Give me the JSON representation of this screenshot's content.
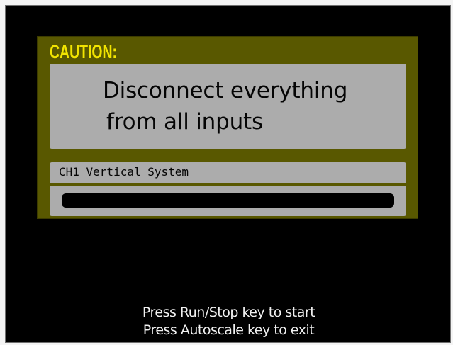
{
  "dialog": {
    "caution_title": "CAUTION:",
    "message_lines": [
      "Disconnect everything",
      "from all inputs"
    ],
    "test_name": "CH1 Vertical System",
    "progress": {
      "value_percent": 0,
      "fill_color": "#2cc92c"
    }
  },
  "instructions": {
    "line1": "Press Run/Stop key to start",
    "line2": "Press Autoscale key to exit"
  },
  "colors": {
    "screen_background": "#000000",
    "dialog_background": "#595800",
    "panel_background": "#acacac",
    "caution_text": "#f2e400",
    "instruction_text": "#f1f1f1"
  }
}
